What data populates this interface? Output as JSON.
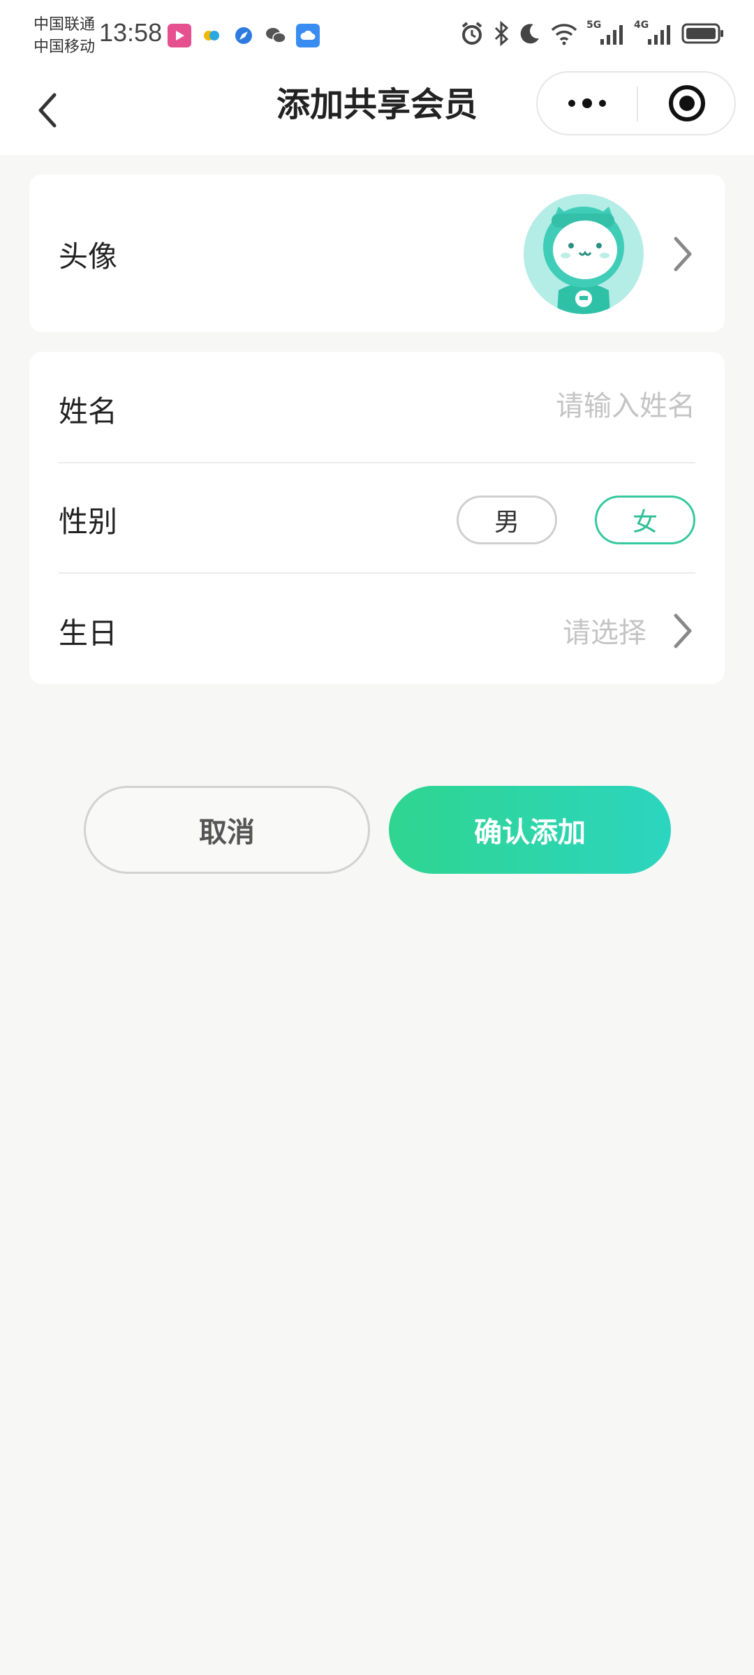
{
  "status_bar": {
    "carrier_1": "中国联通",
    "carrier_2": "中国移动",
    "time": "13:58",
    "network_1": "5G",
    "network_2": "4G"
  },
  "nav": {
    "title": "添加共享会员"
  },
  "avatar_row": {
    "label": "头像"
  },
  "form": {
    "name_label": "姓名",
    "name_placeholder": "请输入姓名",
    "gender_label": "性别",
    "gender_male": "男",
    "gender_female": "女",
    "gender_selected": "女",
    "birthday_label": "生日",
    "birthday_value": "请选择"
  },
  "actions": {
    "cancel_label": "取消",
    "confirm_label": "确认添加"
  },
  "colors": {
    "accent": "#2fc196",
    "confirm_gradient_start": "#2fd58f",
    "confirm_gradient_end": "#2cd5bf",
    "avatar_bg": "#b4ece6"
  }
}
